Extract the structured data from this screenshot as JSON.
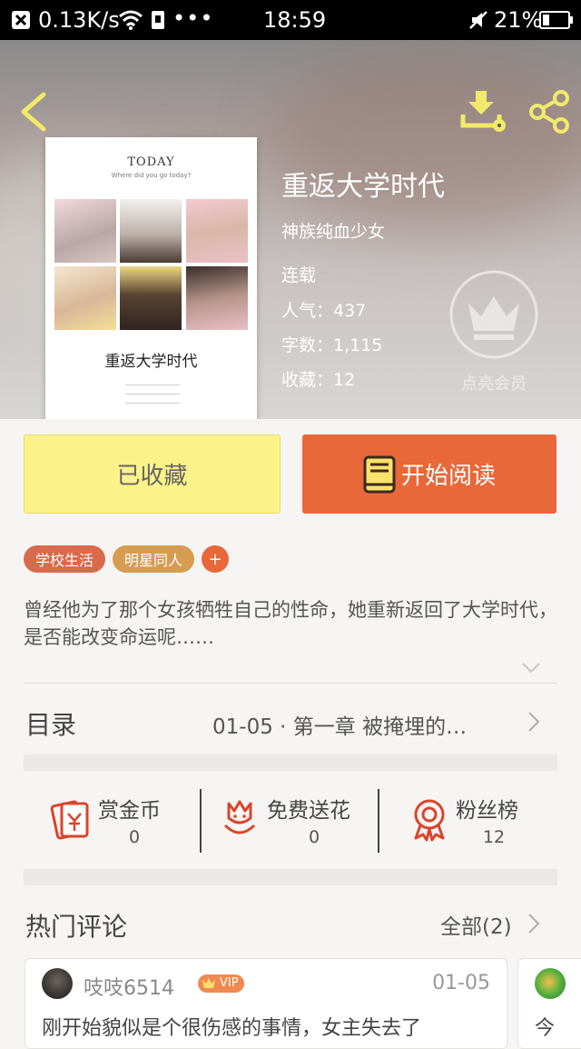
{
  "status_bar": {
    "speed": "0.13K/s",
    "dots": "•••",
    "time": "18:59",
    "battery": "21%"
  },
  "book": {
    "title": "重返大学时代",
    "author": "神族纯血少女",
    "status": "连载",
    "popularity_label": "人气：437",
    "word_count_label": "字数：1,115",
    "favorites_label": "收藏：12",
    "vip_member_label": "点亮会员",
    "cover": {
      "header": "TODAY",
      "subheader": "Where did you go today?",
      "title": "重返大学时代"
    }
  },
  "actions": {
    "favorited_label": "已收藏",
    "start_reading_label": "开始阅读"
  },
  "tags": [
    "学校生活",
    "明星同人"
  ],
  "add_tag_label": "+",
  "description": "曾经他为了那个女孩牺牲自己的性命，她重新返回了大学时代，是否能改变命运呢……",
  "toc": {
    "label": "目录",
    "latest": "01-05 · 第一章 被掩埋的…"
  },
  "stats": [
    {
      "label": "赏金币",
      "value": "0"
    },
    {
      "label": "免费送花",
      "value": "0"
    },
    {
      "label": "粉丝榜",
      "value": "12"
    }
  ],
  "comments": {
    "label": "热门评论",
    "all_label": "全部(2)",
    "items": [
      {
        "user": "吱吱6514",
        "badge": "VIP",
        "date": "01-05",
        "text": "刚开始貌似是个很伤感的事情，女主失去了"
      },
      {
        "text": "今"
      }
    ]
  },
  "colors": {
    "accent_orange": "#e8683a",
    "favorite_yellow": "#fbf28a",
    "tag_school": "#d96a4b",
    "tag_star": "#d59c52"
  }
}
